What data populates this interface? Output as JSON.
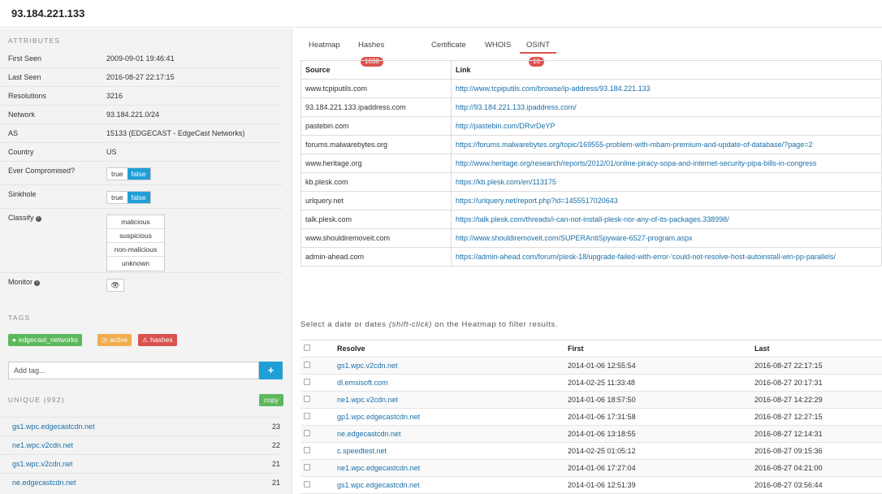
{
  "header": {
    "ip": "93.184.221.133"
  },
  "sidebar": {
    "attributes_title": "ATTRIBUTES",
    "first_seen": {
      "label": "First Seen",
      "value": "2009-09-01 19:46:41"
    },
    "last_seen": {
      "label": "Last Seen",
      "value": "2016-08-27 22:17:15"
    },
    "resolutions": {
      "label": "Resolutions",
      "value": "3216"
    },
    "network": {
      "label": "Network",
      "value": "93.184.221.0/24"
    },
    "as": {
      "label": "AS",
      "value": "15133 (EDGECAST - EdgeCast Networks)"
    },
    "country": {
      "label": "Country",
      "value": "US"
    },
    "ever_compromised": {
      "label": "Ever Compromised?",
      "true_label": "true",
      "false_label": "false",
      "selected": "false"
    },
    "sinkhole": {
      "label": "Sinkhole",
      "true_label": "true",
      "false_label": "false",
      "selected": "false"
    },
    "classify": {
      "label": "Classify",
      "options": [
        "malicious",
        "suspicious",
        "non-malicious",
        "unknown"
      ]
    },
    "monitor": {
      "label": "Monitor"
    },
    "tags_title": "TAGS",
    "tags": [
      {
        "label": "edgecast_networks",
        "color": "#5cb85c",
        "icon": "tag-icon"
      },
      {
        "label": "active",
        "color": "#f0ad4e",
        "icon": "clock-icon"
      },
      {
        "label": "hashes",
        "color": "#d9534f",
        "icon": "warning-icon"
      }
    ],
    "add_tag_placeholder": "Add tag...",
    "add_tag_button": "+",
    "unique_title": "UNIQUE (992)",
    "copy_label": "copy",
    "unique": [
      {
        "name": "gs1.wpc.edgecastcdn.net",
        "count": "23"
      },
      {
        "name": "ne1.wpc.v2cdn.net",
        "count": "22"
      },
      {
        "name": "gs1.wpc.v2cdn.net",
        "count": "21"
      },
      {
        "name": "ne.edgecastcdn.net",
        "count": "21"
      }
    ]
  },
  "tabs": [
    {
      "label": "Heatmap",
      "badge": ""
    },
    {
      "label": "Hashes",
      "badge": "1038"
    },
    {
      "label": "Certificate",
      "badge": ""
    },
    {
      "label": "WHOIS",
      "badge": ""
    },
    {
      "label": "OSINT",
      "badge": "10",
      "active": true
    }
  ],
  "osint": {
    "headers": {
      "source": "Source",
      "link": "Link"
    },
    "rows": [
      {
        "source": "www.tcpiputils.com",
        "link": "http://www.tcpiputils.com/browse/ip-address/93.184.221.133"
      },
      {
        "source": "93.184.221.133.ipaddress.com",
        "link": "http://93.184.221.133.ipaddress.com/"
      },
      {
        "source": "pastebin.com",
        "link": "http://pastebin.com/DRvrDeYP"
      },
      {
        "source": "forums.malwarebytes.org",
        "link": "https://forums.malwarebytes.org/topic/169555-problem-with-mbam-premium-and-update-of-database/?page=2"
      },
      {
        "source": "www.heritage.org",
        "link": "http://www.heritage.org/research/reports/2012/01/online-piracy-sopa-and-internet-security-pipa-bills-in-congress"
      },
      {
        "source": "kb.plesk.com",
        "link": "https://kb.plesk.com/en/113175"
      },
      {
        "source": "urlquery.net",
        "link": "https://urlquery.net/report.php?id=1455517020643"
      },
      {
        "source": "talk.plesk.com",
        "link": "https://talk.plesk.com/threads/i-can-not-install-plesk-nor-any-of-its-packages.338998/"
      },
      {
        "source": "www.shouldiremoveit.com",
        "link": "http://www.shouldiremoveit.com/SUPERAntiSpyware-6527-program.aspx"
      },
      {
        "source": "admin-ahead.com",
        "link": "https://admin-ahead.com/forum/plesk-18/upgrade-failed-with-error-'could-not-resolve-host-autoinstall-win-pp-parallels/"
      }
    ]
  },
  "hint": {
    "before": "Select a date or dates ",
    "italic": "(shift-click)",
    "after": " on the Heatmap to filter results."
  },
  "resolutions_table": {
    "headers": {
      "resolve": "Resolve",
      "first": "First",
      "last": "Last"
    },
    "rows": [
      {
        "resolve": "gs1.wpc.v2cdn.net",
        "first": "2014-01-06 12:55:54",
        "last": "2016-08-27 22:17:15"
      },
      {
        "resolve": "dl.emsisoft.com",
        "first": "2014-02-25 11:33:48",
        "last": "2016-08-27 20:17:31"
      },
      {
        "resolve": "ne1.wpc.v2cdn.net",
        "first": "2014-01-06 18:57:50",
        "last": "2016-08-27 14:22:29"
      },
      {
        "resolve": "gp1.wpc.edgecastcdn.net",
        "first": "2014-01-06 17:31:58",
        "last": "2016-08-27 12:27:15"
      },
      {
        "resolve": "ne.edgecastcdn.net",
        "first": "2014-01-06 13:18:55",
        "last": "2016-08-27 12:14:31"
      },
      {
        "resolve": "c.speedtest.net",
        "first": "2014-02-25 01:05:12",
        "last": "2016-08-27 09:15:36"
      },
      {
        "resolve": "ne1.wpc.edgecastcdn.net",
        "first": "2014-01-06 17:27:04",
        "last": "2016-08-27 04:21:00"
      },
      {
        "resolve": "gs1.wpc.edgecastcdn.net",
        "first": "2014-01-06 12:51:39",
        "last": "2016-08-27 03:56:44"
      }
    ]
  }
}
